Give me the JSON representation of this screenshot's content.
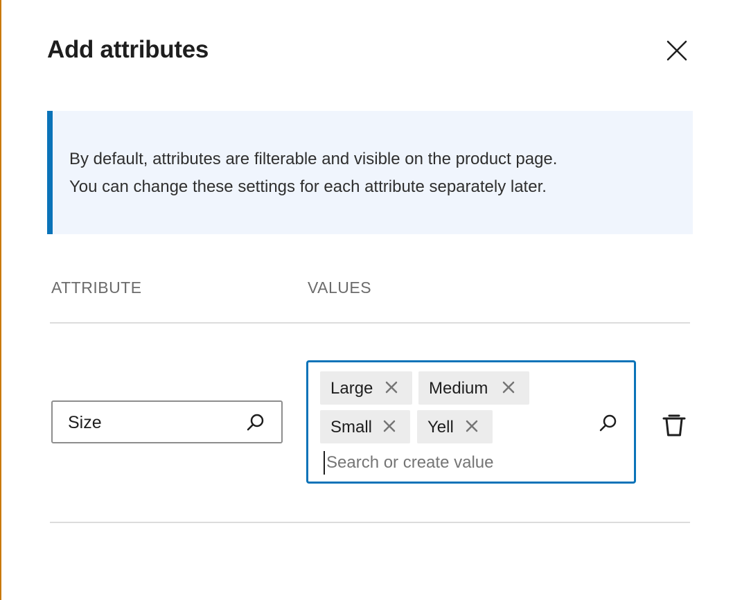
{
  "modal": {
    "title": "Add attributes",
    "close_icon": "close-icon"
  },
  "notice": {
    "line1": "By default, attributes are filterable and visible on the product page.",
    "line2": "You can change these settings for each attribute separately later."
  },
  "table": {
    "headers": [
      "ATTRIBUTE",
      "VALUES"
    ],
    "row": {
      "attribute": {
        "value": "Size",
        "icon": "search-icon"
      },
      "values": {
        "chips": [
          {
            "label": "Large"
          },
          {
            "label": "Medium"
          },
          {
            "label": "Small"
          },
          {
            "label": "Yell"
          }
        ],
        "placeholder": "Search or create value",
        "icon": "search-icon"
      },
      "remove_icon": "trash-icon"
    }
  },
  "colors": {
    "accent": "#0a73b8",
    "notice_bg": "#f0f5fd",
    "chip_bg": "#ececec",
    "frame_edge": "#c9790b"
  }
}
